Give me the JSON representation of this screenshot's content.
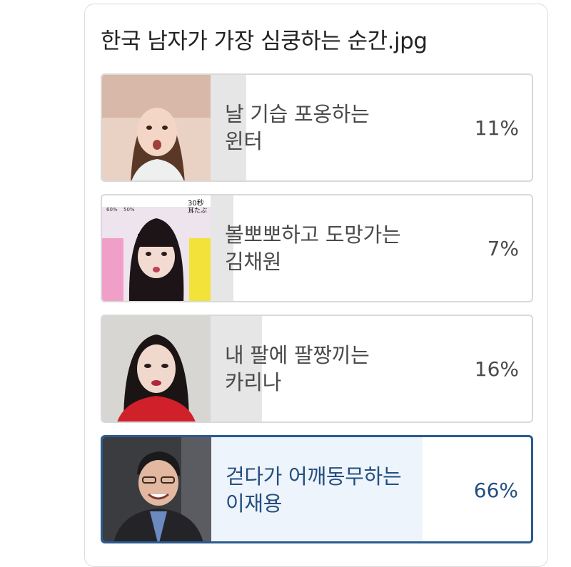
{
  "poll": {
    "title": "한국 남자가 가장 심쿵하는 순간.jpg",
    "options": [
      {
        "label": "날 기습 포옹하는\n윈터",
        "percent": "11%",
        "fill": 0.11,
        "selected": false,
        "thumbnail": "photo-woman-smiling"
      },
      {
        "label": "볼뽀뽀하고 도망가는\n김채원",
        "percent": "7%",
        "fill": 0.07,
        "selected": false,
        "thumbnail": "photo-woman-pouting",
        "thumbnail_text": [
          "30秒",
          "耳たぶ",
          "60%",
          "50%"
        ]
      },
      {
        "label": "내 팔에 팔짱끼는\n카리나",
        "percent": "16%",
        "fill": 0.16,
        "selected": false,
        "thumbnail": "photo-woman-red-outfit"
      },
      {
        "label": "걷다가 어깨동무하는\n이재용",
        "percent": "66%",
        "fill": 0.66,
        "selected": true,
        "thumbnail": "photo-man-suit"
      }
    ]
  },
  "colors": {
    "bar_fill": "#e6e6e6",
    "selected_border": "#2a5b8f",
    "selected_text": "#234f80",
    "selected_bar": "#eef4fb"
  }
}
